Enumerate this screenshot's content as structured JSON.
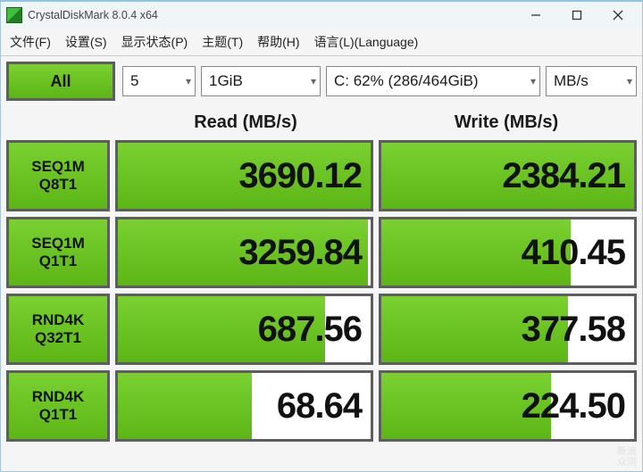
{
  "window": {
    "title": "CrystalDiskMark 8.0.4 x64"
  },
  "menu": {
    "file": "文件(F)",
    "settings": "设置(S)",
    "display": "显示状态(P)",
    "theme": "主题(T)",
    "help": "帮助(H)",
    "language": "语言(L)(Language)"
  },
  "controls": {
    "all_label": "All",
    "count": "5",
    "size": "1GiB",
    "drive": "C: 62% (286/464GiB)",
    "unit": "MB/s"
  },
  "headers": {
    "read": "Read (MB/s)",
    "write": "Write (MB/s)"
  },
  "tests": [
    {
      "line1": "SEQ1M",
      "line2": "Q8T1",
      "read": "3690.12",
      "read_pct": 100,
      "write": "2384.21",
      "write_pct": 100
    },
    {
      "line1": "SEQ1M",
      "line2": "Q1T1",
      "read": "3259.84",
      "read_pct": 99,
      "write": "410.45",
      "write_pct": 75
    },
    {
      "line1": "RND4K",
      "line2": "Q32T1",
      "read": "687.56",
      "read_pct": 82,
      "write": "377.58",
      "write_pct": 74
    },
    {
      "line1": "RND4K",
      "line2": "Q1T1",
      "read": "68.64",
      "read_pct": 53,
      "write": "224.50",
      "write_pct": 67
    }
  ],
  "watermark": {
    "line1": "新浪",
    "line2": "众测"
  }
}
